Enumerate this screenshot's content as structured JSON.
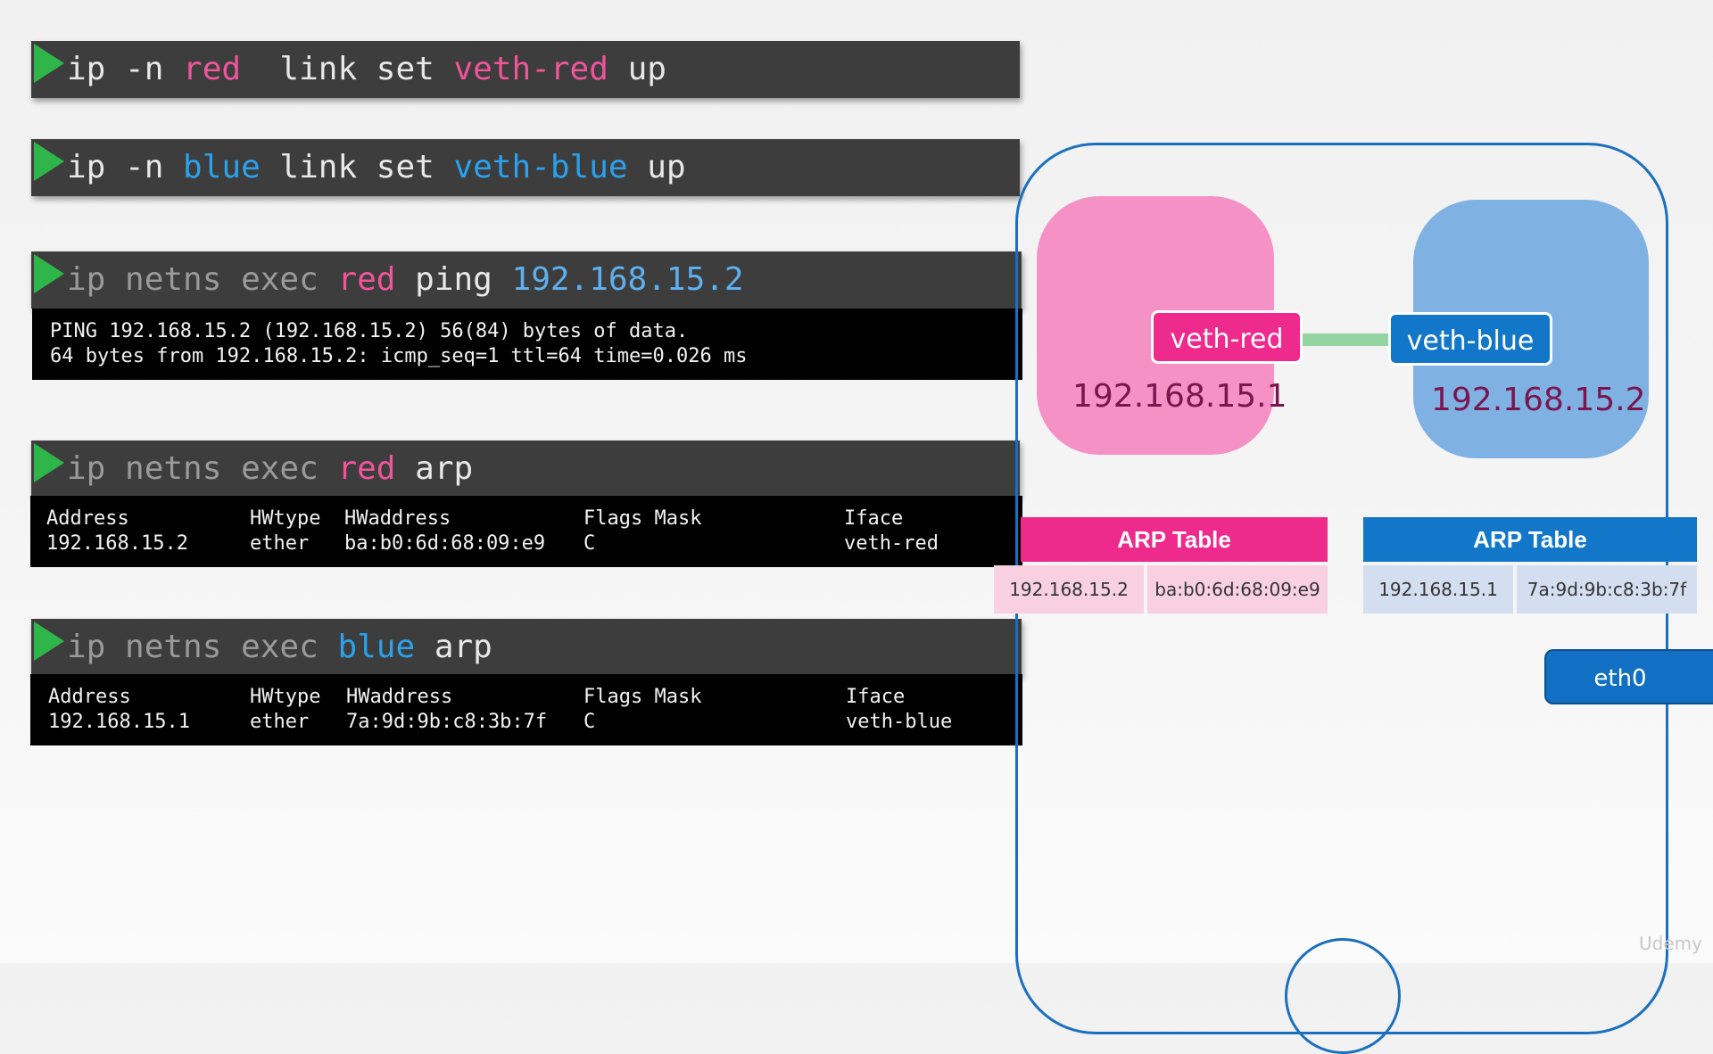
{
  "commands": {
    "c1": {
      "w1": "ip -n ",
      "ns": "red",
      "w2": "  link set ",
      "dev": "veth-red",
      "w3": " up"
    },
    "c2": {
      "w1": "ip -n ",
      "ns": "blue",
      "w2": " link set ",
      "dev": "veth-blue",
      "w3": " up"
    },
    "c3": {
      "w1": "ip netns exec ",
      "ns": "red",
      "w2": " ping ",
      "ip": "192.168.15.2"
    },
    "c4": {
      "w1": "ip netns exec ",
      "ns": "red",
      "w2": " arp"
    },
    "c5": {
      "w1": "ip netns exec ",
      "ns": "blue",
      "w2": " arp"
    }
  },
  "ping_output": {
    "line1": "PING 192.168.15.2 (192.168.15.2) 56(84) bytes of data.",
    "line2": "64 bytes from 192.168.15.2: icmp_seq=1 ttl=64 time=0.026 ms"
  },
  "arp_red": {
    "headers": {
      "address": "Address",
      "hwtype": "HWtype",
      "hwaddress": "HWaddress",
      "flags": "Flags Mask",
      "iface": "Iface"
    },
    "row": {
      "address": "192.168.15.2",
      "hwtype": "ether",
      "hwaddress": "ba:b0:6d:68:09:e9",
      "flags": "C",
      "iface": "veth-red"
    }
  },
  "arp_blue": {
    "headers": {
      "address": "Address",
      "hwtype": "HWtype",
      "hwaddress": "HWaddress",
      "flags": "Flags Mask",
      "iface": "Iface"
    },
    "row": {
      "address": "192.168.15.1",
      "hwtype": "ether",
      "hwaddress": "7a:9d:9b:c8:3b:7f",
      "flags": "C",
      "iface": "veth-blue"
    }
  },
  "diagram": {
    "red_ns_ip": "192.168.15.1",
    "blue_ns_ip": "192.168.15.2",
    "veth_red_label": "veth-red",
    "veth_blue_label": "veth-blue",
    "red_arp": {
      "title": "ARP Table",
      "ip": "192.168.15.2",
      "mac": "ba:b0:6d:68:09:e9"
    },
    "blue_arp": {
      "title": "ARP Table",
      "ip": "192.168.15.1",
      "mac": "7a:9d:9b:c8:3b:7f"
    },
    "eth0_label": "eth0"
  },
  "watermark": "Udemy",
  "colors": {
    "terminal_bg": "#3d3d3d",
    "prompt_green": "#2fb64a",
    "red_accent": "#f0559a",
    "blue_accent": "#2aa2ee",
    "red_ns_fill": "#f591c4",
    "blue_ns_fill": "#7fb2e2",
    "red_arp_header": "#ee2a8c",
    "blue_arp_header": "#1377c9",
    "host_outline": "#1a6fbf"
  }
}
